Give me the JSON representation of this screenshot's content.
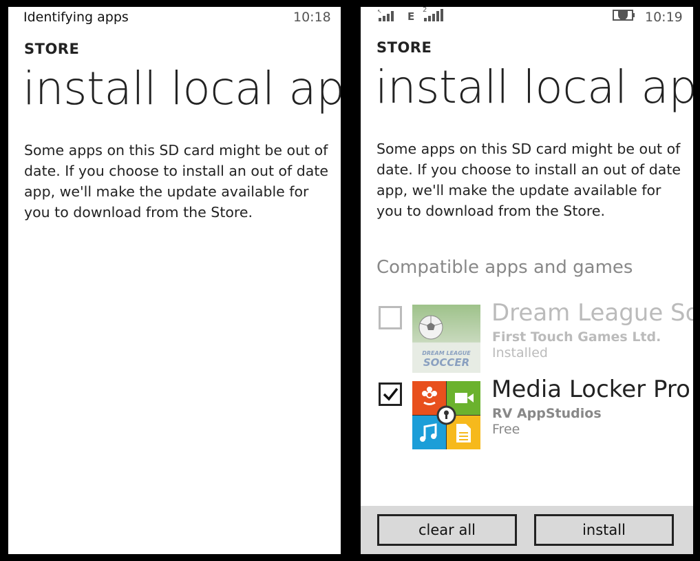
{
  "left_screen": {
    "status_text": "Identifying apps",
    "clock": "10:18",
    "store_label": "STORE",
    "page_title": "install local apps",
    "description": "Some apps on this SD card might be out of date. If you choose to install an out of date app, we'll make the update available for you to download from the Store."
  },
  "right_screen": {
    "status": {
      "network_type": "E",
      "sim2_label": "2",
      "clock": "10:19"
    },
    "store_label": "STORE",
    "page_title": "install local apps",
    "description": "Some apps on this SD card might be out of date. If you choose to install an out of date app, we'll make the update available for you to download from the Store.",
    "section_title": "Compatible apps and games",
    "apps": [
      {
        "name": "Dream League Soccer",
        "publisher": "First Touch Games Ltd.",
        "status": "Installed",
        "icon_text_1": "DREAM LEAGUE",
        "icon_text_2": "SOCCER",
        "checked": false
      },
      {
        "name": "Media Locker Pro",
        "publisher": "RV AppStudios",
        "status": "Free",
        "checked": true
      }
    ],
    "buttons": {
      "clear_all": "clear all",
      "install": "install"
    }
  },
  "colors": {
    "background": "#000000",
    "screen": "#ffffff",
    "appbar": "#d9d9d9",
    "faded_text": "#bbbbbb",
    "subtle_text": "#888888",
    "tile_orange": "#e8501d",
    "tile_green": "#6bb22e",
    "tile_blue": "#1c9ed8",
    "tile_yellow": "#f6b91c"
  }
}
